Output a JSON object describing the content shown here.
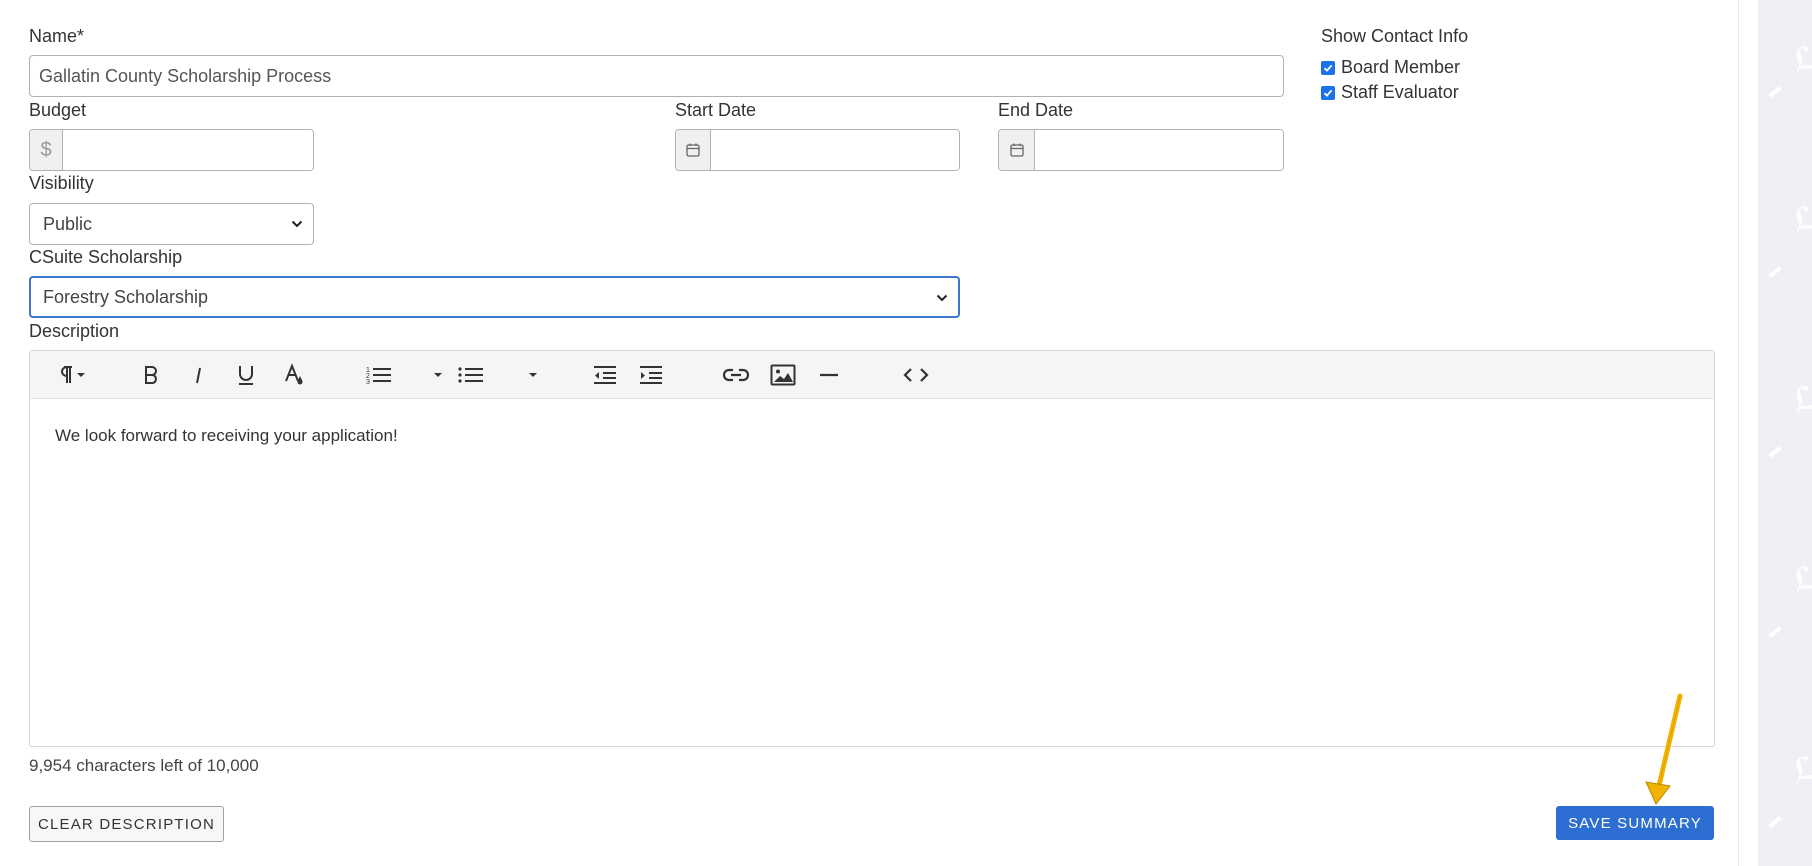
{
  "form": {
    "name": {
      "label": "Name*",
      "value": "Gallatin County Scholarship Process"
    },
    "budget": {
      "label": "Budget",
      "prefix": "$",
      "value": ""
    },
    "start_date": {
      "label": "Start Date",
      "value": ""
    },
    "end_date": {
      "label": "End Date",
      "value": ""
    },
    "visibility": {
      "label": "Visibility",
      "selected": "Public"
    },
    "csuite_scholarship": {
      "label": "CSuite Scholarship",
      "selected": "Forestry Scholarship"
    },
    "show_contact_info": {
      "label": "Show Contact Info",
      "options": [
        {
          "label": "Board Member",
          "checked": true
        },
        {
          "label": "Staff Evaluator",
          "checked": true
        }
      ]
    },
    "description": {
      "label": "Description",
      "toolbar": [
        "paragraph-icon",
        "bold-icon",
        "italic-icon",
        "underline-icon",
        "text-color-icon",
        "ordered-list-icon",
        "unordered-list-icon",
        "outdent-icon",
        "indent-icon",
        "link-icon",
        "image-icon",
        "horizontal-rule-icon",
        "code-view-icon"
      ],
      "content": "We look forward to receiving your application!",
      "counter": "9,954 characters left of 10,000"
    }
  },
  "actions": {
    "clear_label": "CLEAR DESCRIPTION",
    "save_label": "SAVE SUMMARY"
  },
  "colors": {
    "primary": "#2d6ed3",
    "focus_border": "#3d76cc",
    "annotation_arrow": "#f2b400",
    "rail": "#eef0f6"
  }
}
